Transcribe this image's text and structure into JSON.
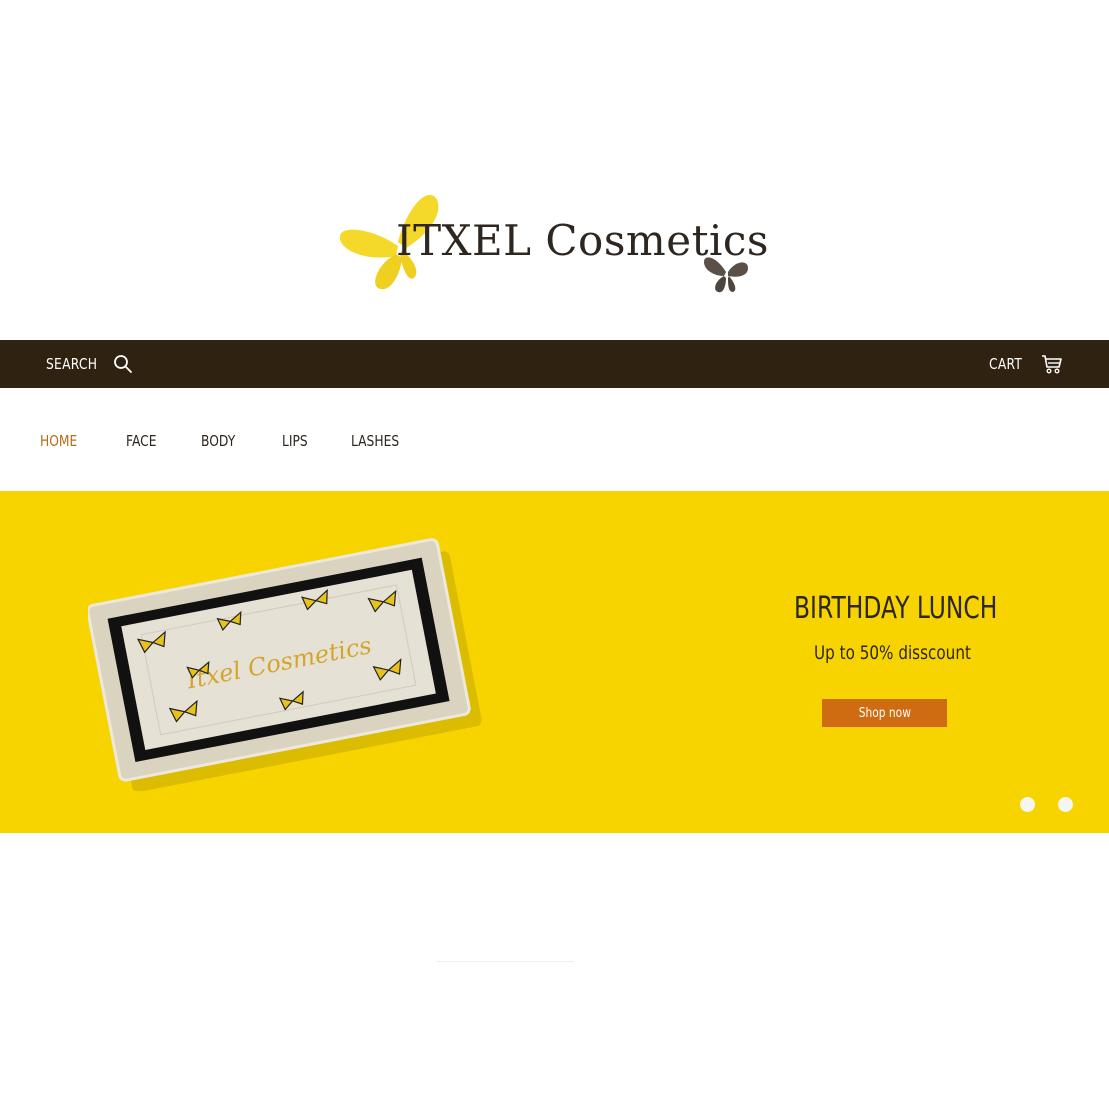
{
  "brand": {
    "name": "ITXEL Cosmetics",
    "colors": {
      "butterfly_yellow": "#f5d92a",
      "butterfly_gray": "#5a5048",
      "text": "#2e2620"
    }
  },
  "topbar": {
    "background": "#302211",
    "search_label": "SEARCH",
    "search_icon": "search-icon",
    "cart_label": "CART",
    "cart_icon": "cart-icon"
  },
  "nav": {
    "items": [
      {
        "label": "HOME",
        "active": true
      },
      {
        "label": "FACE",
        "active": false
      },
      {
        "label": "BODY",
        "active": false
      },
      {
        "label": "LIPS",
        "active": false
      },
      {
        "label": "LASHES",
        "active": false
      }
    ],
    "active_color": "#b86d18"
  },
  "hero": {
    "background": "#f7d400",
    "title": "BIRTHDAY LUNCH",
    "subtitle": "Up to 50% disscount",
    "button_label": "Shop now",
    "button_color": "#cf6b11",
    "product_image_text": "Itxel Cosmetics",
    "slides": 2
  }
}
